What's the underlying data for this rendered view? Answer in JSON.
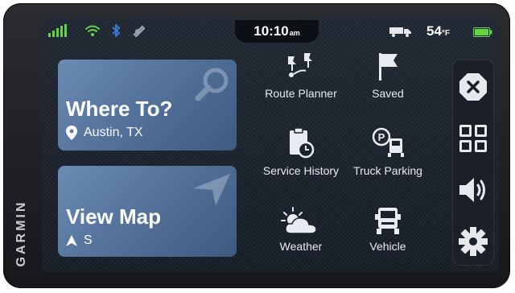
{
  "brand": "GARMIN",
  "status_bar": {
    "time": "10:10",
    "ampm": "am",
    "temperature": "54",
    "temperature_unit": "°F",
    "icons": [
      "signal-bars-icon",
      "wifi-icon",
      "bluetooth-icon",
      "phone-app-icon",
      "truck-icon",
      "battery-icon"
    ]
  },
  "cards": {
    "where_to": {
      "title": "Where To?",
      "subtitle": "Austin, TX",
      "icon": "location-pin-icon"
    },
    "view_map": {
      "title": "View Map",
      "subtitle": "S",
      "icon": "heading-arrow-icon"
    }
  },
  "tiles": [
    {
      "label": "Route Planner",
      "icon": "route-planner-icon"
    },
    {
      "label": "Saved",
      "icon": "flag-icon"
    },
    {
      "label": "Service History",
      "icon": "service-history-icon"
    },
    {
      "label": "Truck Parking",
      "icon": "truck-parking-icon"
    },
    {
      "label": "Weather",
      "icon": "weather-icon"
    },
    {
      "label": "Vehicle",
      "icon": "vehicle-icon"
    }
  ],
  "sidebar": [
    "close-icon",
    "apps-grid-icon",
    "volume-icon",
    "settings-gear-icon"
  ],
  "colors": {
    "accent_green": "#63d44a",
    "bluetooth_blue": "#3a7bd5",
    "card_blue": "#5f7fa8"
  }
}
